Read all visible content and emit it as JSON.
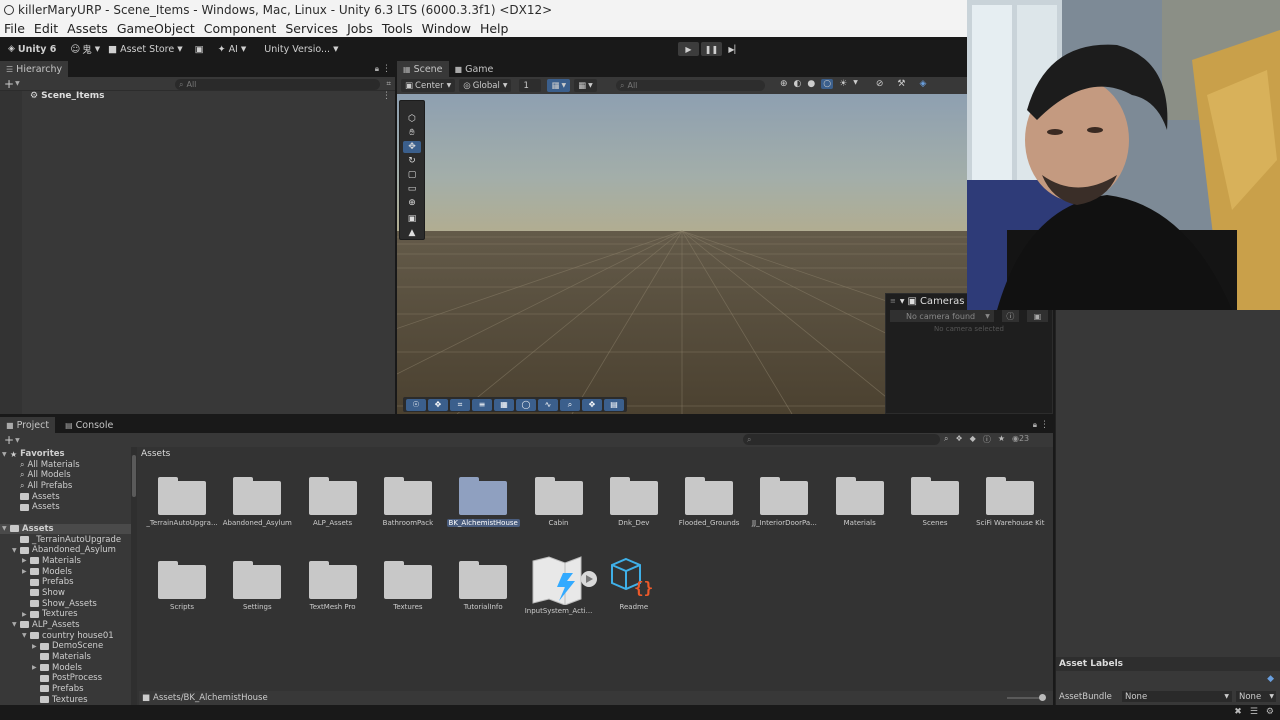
{
  "window": {
    "title": "killerMaryURP - Scene_Items - Windows, Mac, Linux - Unity 6.3 LTS (6000.3.3f1) <DX12>"
  },
  "menu": [
    "File",
    "Edit",
    "Assets",
    "GameObject",
    "Component",
    "Services",
    "Jobs",
    "Tools",
    "Window",
    "Help"
  ],
  "toolbar": {
    "unity_label": "Unity 6",
    "account_label": "鬼",
    "asset_store_label": "Asset Store",
    "ai_label": "AI",
    "version_label": "Unity Versio..."
  },
  "hierarchy": {
    "tab": "Hierarchy",
    "search_placeholder": "All",
    "scene_name": "Scene_Items"
  },
  "scene": {
    "tabs": [
      "Scene",
      "Game"
    ],
    "pivot_label": "Center",
    "space_label": "Global",
    "snap_value": "1",
    "search_placeholder": "All"
  },
  "cameras": {
    "title": "Cameras",
    "select_label": "No camera found",
    "empty_label": "No camera selected"
  },
  "project": {
    "tabs": [
      "Project",
      "Console"
    ],
    "count": "23",
    "breadcrumb": "Assets",
    "path": "Assets/BK_AlchemistHouse",
    "tree": [
      {
        "label": "Favorites",
        "depth": 0,
        "kind": "star",
        "arrow": "▼"
      },
      {
        "label": "All Materials",
        "depth": 1,
        "kind": "search"
      },
      {
        "label": "All Models",
        "depth": 1,
        "kind": "search"
      },
      {
        "label": "All Prefabs",
        "depth": 1,
        "kind": "search"
      },
      {
        "label": "Assets",
        "depth": 1,
        "kind": "folder"
      },
      {
        "label": "Assets",
        "depth": 1,
        "kind": "folder"
      },
      {
        "label": "",
        "depth": 0,
        "kind": "gap"
      },
      {
        "label": "Assets",
        "depth": 0,
        "kind": "folder",
        "arrow": "▼",
        "selected": true
      },
      {
        "label": "_TerrainAutoUpgrade",
        "depth": 1,
        "kind": "folder"
      },
      {
        "label": "Abandoned_Asylum",
        "depth": 1,
        "kind": "folder",
        "arrow": "▼"
      },
      {
        "label": "Materials",
        "depth": 2,
        "kind": "folder",
        "arrow": "▶"
      },
      {
        "label": "Models",
        "depth": 2,
        "kind": "folder",
        "arrow": "▶"
      },
      {
        "label": "Prefabs",
        "depth": 2,
        "kind": "folder"
      },
      {
        "label": "Show",
        "depth": 2,
        "kind": "folder"
      },
      {
        "label": "Show_Assets",
        "depth": 2,
        "kind": "folder"
      },
      {
        "label": "Textures",
        "depth": 2,
        "kind": "folder",
        "arrow": "▶"
      },
      {
        "label": "ALP_Assets",
        "depth": 1,
        "kind": "folder",
        "arrow": "▼"
      },
      {
        "label": "country house01",
        "depth": 2,
        "kind": "folder",
        "arrow": "▼"
      },
      {
        "label": "DemoScene",
        "depth": 3,
        "kind": "folder",
        "arrow": "▶"
      },
      {
        "label": "Materials",
        "depth": 3,
        "kind": "folder"
      },
      {
        "label": "Models",
        "depth": 3,
        "kind": "folder",
        "arrow": "▶"
      },
      {
        "label": "PostProcess",
        "depth": 3,
        "kind": "folder"
      },
      {
        "label": "Prefabs",
        "depth": 3,
        "kind": "folder"
      },
      {
        "label": "Textures",
        "depth": 3,
        "kind": "folder"
      }
    ],
    "assets": [
      {
        "label": "_TerrainAutoUpgra...",
        "type": "folder"
      },
      {
        "label": "Abandoned_Asylum",
        "type": "folder"
      },
      {
        "label": "ALP_Assets",
        "type": "folder"
      },
      {
        "label": "BathroomPack",
        "type": "folder"
      },
      {
        "label": "BK_AlchemistHouse",
        "type": "folder",
        "selected": true
      },
      {
        "label": "Cabin",
        "type": "folder"
      },
      {
        "label": "Dnk_Dev",
        "type": "folder"
      },
      {
        "label": "Flooded_Grounds",
        "type": "folder"
      },
      {
        "label": "JJ_InteriorDoorPa...",
        "type": "folder"
      },
      {
        "label": "Materials",
        "type": "folder"
      },
      {
        "label": "Scenes",
        "type": "folder"
      },
      {
        "label": "SciFi Warehouse Kit",
        "type": "folder"
      },
      {
        "label": "Scripts",
        "type": "folder"
      },
      {
        "label": "Settings",
        "type": "folder"
      },
      {
        "label": "TextMesh Pro",
        "type": "folder"
      },
      {
        "label": "Textures",
        "type": "folder"
      },
      {
        "label": "TutorialInfo",
        "type": "folder"
      },
      {
        "label": "InputSystem_Acti...",
        "type": "inputactions"
      },
      {
        "label": "Readme",
        "type": "readme"
      }
    ]
  },
  "inspector": {
    "asset_labels": "Asset Labels",
    "bundle_label": "AssetBundle",
    "bundle_value": "None",
    "variant_value": "None"
  },
  "colors": {
    "accent": "#3b5f8c",
    "panel": "#383838",
    "background": "#191919"
  }
}
